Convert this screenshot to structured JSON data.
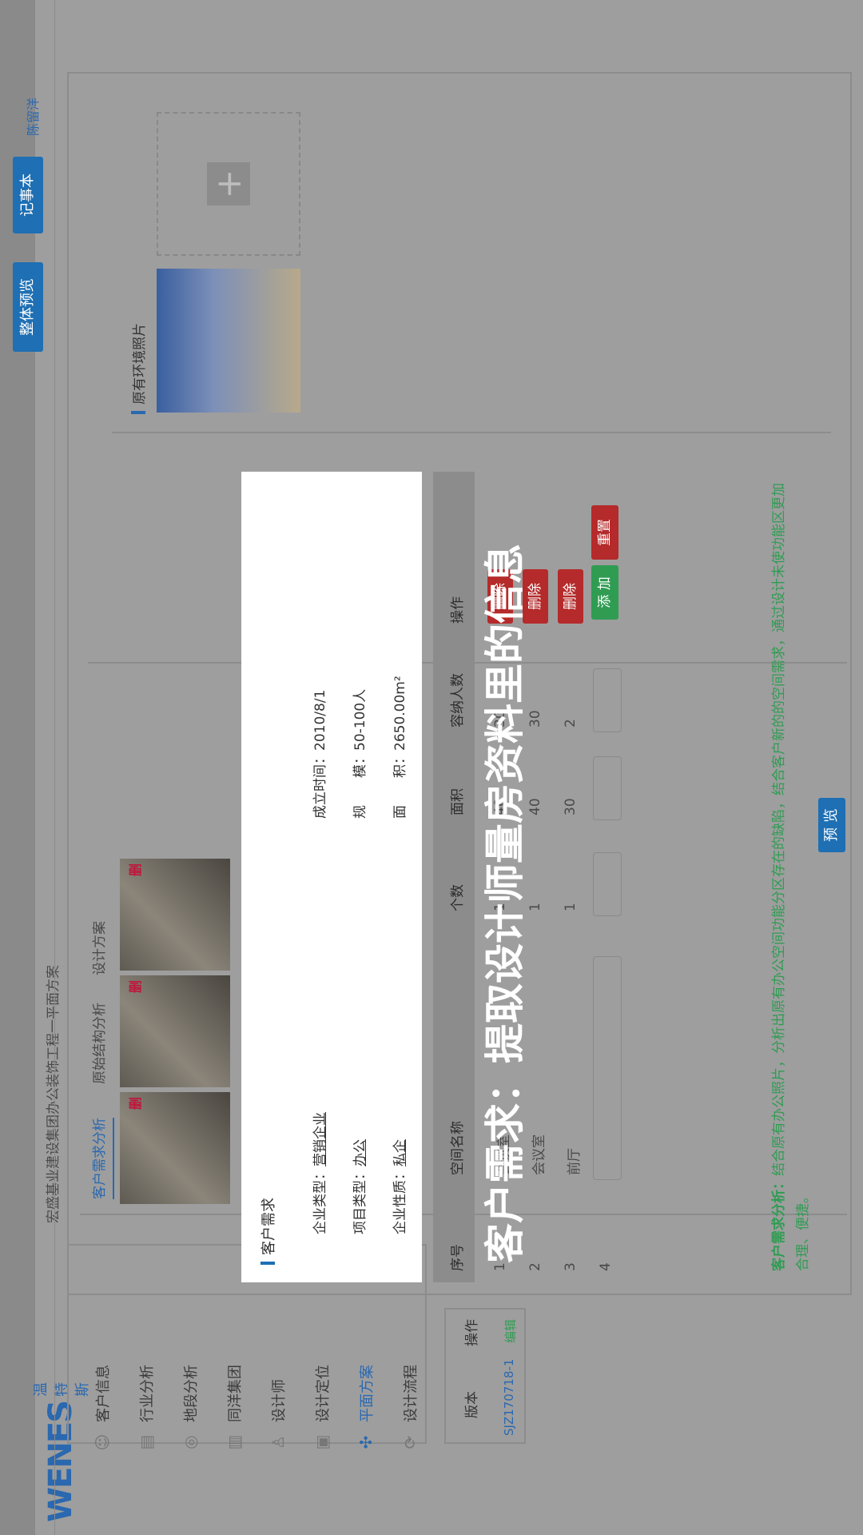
{
  "header": {
    "project_title": "宏盛基业建设集团办公装饰工程一平面方案",
    "btn_overview": "整体预览",
    "btn_notebook": "记事本",
    "user_name": "陈留洋"
  },
  "logo": {
    "brand": "WENES",
    "brand_cn": "温特斯"
  },
  "sidebar": {
    "items": [
      {
        "label": "客户信息",
        "icon": "user-icon"
      },
      {
        "label": "行业分析",
        "icon": "chart-icon"
      },
      {
        "label": "地段分析",
        "icon": "location-icon"
      },
      {
        "label": "同洋集团",
        "icon": "building-icon"
      },
      {
        "label": "设计师",
        "icon": "designer-icon"
      },
      {
        "label": "设计定位",
        "icon": "document-icon"
      },
      {
        "label": "平面方案",
        "icon": "layout-icon",
        "active": true
      },
      {
        "label": "设计流程",
        "icon": "flow-icon"
      }
    ]
  },
  "version_table": {
    "headers": [
      "版本",
      "操作"
    ],
    "rows": [
      {
        "version": "SJZ170718-1",
        "action": "编辑"
      }
    ]
  },
  "tabs": [
    "客户需求分析",
    "原始结构分析",
    "设计方案"
  ],
  "photos": {
    "tag": "删"
  },
  "env_photos": {
    "title": "原有环境照片"
  },
  "client_needs": {
    "title": "客户需求",
    "left": [
      {
        "label": "企业类型：",
        "value": "营销企业"
      },
      {
        "label": "项目类型：",
        "value": "办公"
      },
      {
        "label": "企业性质：",
        "value": "私企"
      }
    ],
    "right": [
      {
        "label": "成立时间：",
        "value": "2010/8/1"
      },
      {
        "label": "规　　模：",
        "value": "50-100人"
      },
      {
        "label": "面　　积：",
        "value": "2650.00m²"
      }
    ]
  },
  "space_table": {
    "headers": [
      "序号",
      "空间名称",
      "个数",
      "面积",
      "容纳人数",
      "操作"
    ],
    "rows": [
      {
        "no": "1",
        "name": "会议室",
        "count": "1",
        "area": "40",
        "people": "30",
        "op": "删除"
      },
      {
        "no": "2",
        "name": "会议室",
        "count": "1",
        "area": "40",
        "people": "30",
        "op": "删除"
      },
      {
        "no": "3",
        "name": "前厅",
        "count": "1",
        "area": "30",
        "people": "2",
        "op": "删除"
      },
      {
        "no": "4",
        "name": "",
        "count": "",
        "area": "",
        "people": "",
        "op": ""
      }
    ],
    "btn_reset": "重置",
    "btn_add": "添 加",
    "btn_preview": "预 览"
  },
  "analysis": {
    "label": "客户需求分析：",
    "text": "结合原有办公照片，分析出原有办公空间功能分区存在的缺陷，结合客户新的的空间需求，通过设计未使功能区更加合理、便捷。"
  },
  "overlay_caption": "客户需求：提取设计师量房资料里的信息",
  "colors": {
    "accent_blue": "#1e6fb3",
    "danger_red": "#b52a2a",
    "success_green": "#2f9c52",
    "overlay": "#9e9e9e"
  }
}
